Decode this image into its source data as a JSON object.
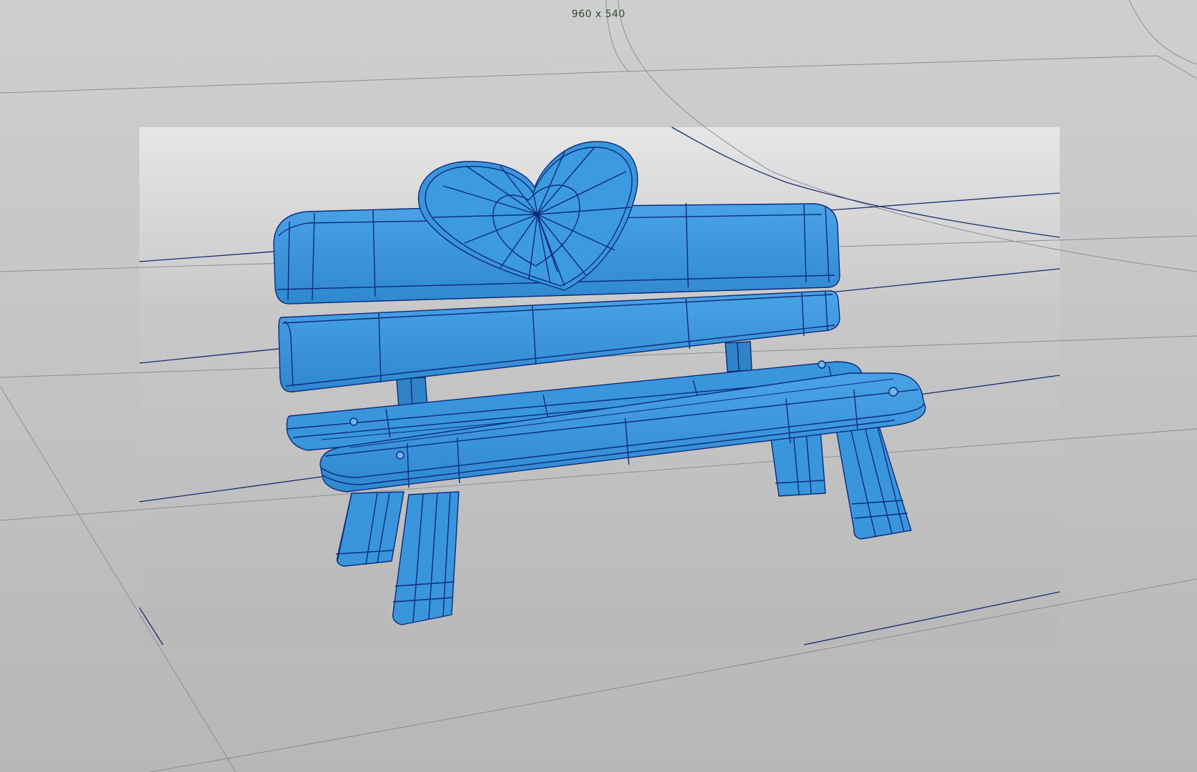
{
  "viewport": {
    "resolution_label": "960 x 540",
    "colors": {
      "background": "#bdbdbd",
      "model_fill": "#3a96dc",
      "model_shade": "#2f84c8",
      "wire": "#0b2a7a",
      "grid_light": "#8a8f99",
      "grid_dark": "#1a2b6e",
      "resolution_gate": "#c2c2c2"
    },
    "model": {
      "name": "heart-back-bench",
      "display_mode": "wireframe-on-shaded"
    }
  }
}
